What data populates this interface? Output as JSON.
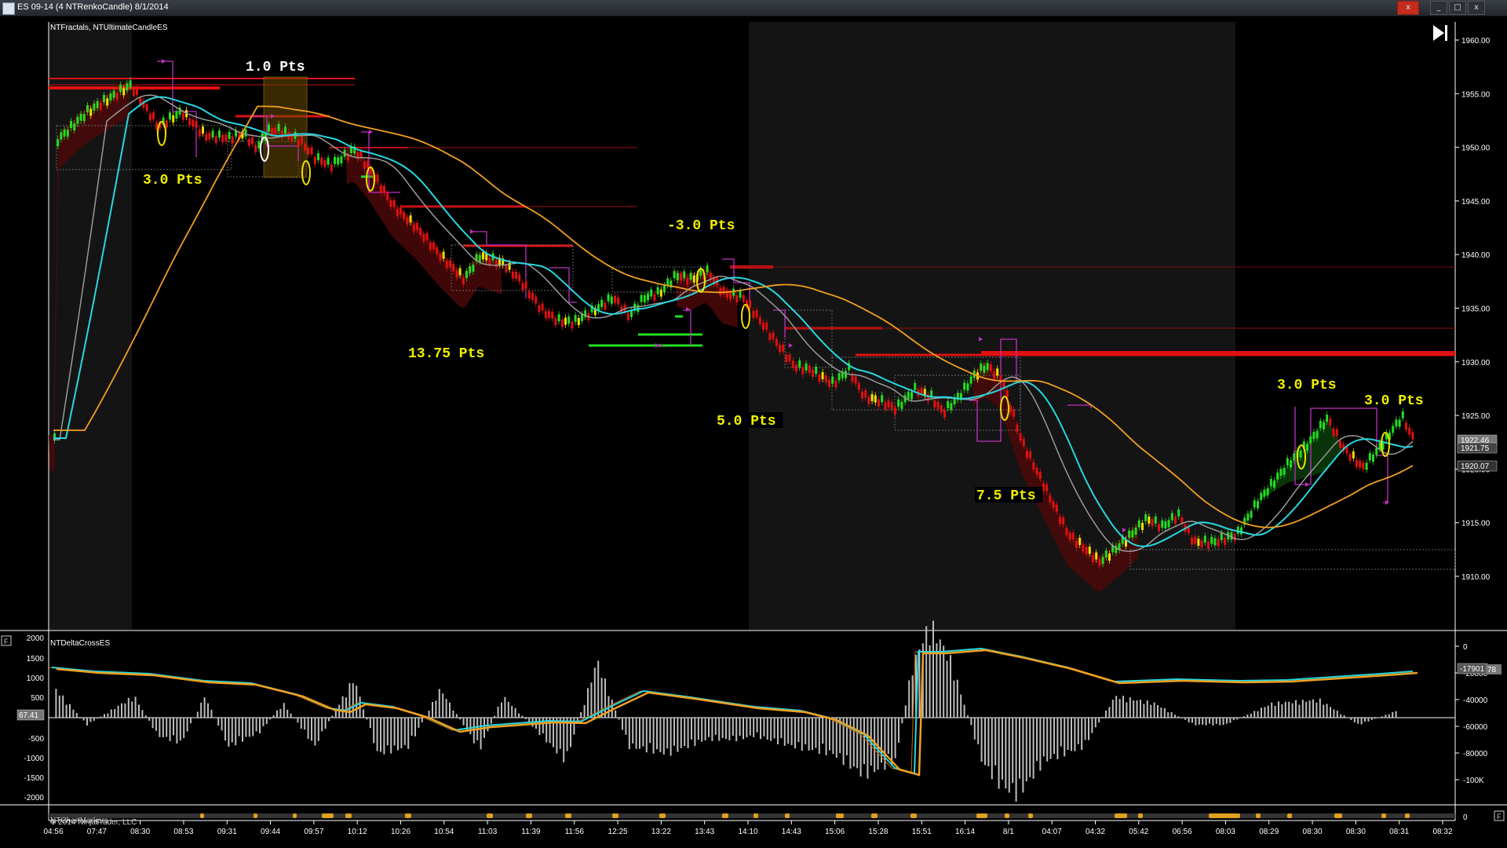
{
  "window": {
    "title": "ES 09-14 (4 NTRenkoCandle)  8/1/2014",
    "close_label": "x"
  },
  "main_panel": {
    "indicator_label": "NTFractals, NTUltimateCandleES",
    "price_ticks": [
      "1960.00",
      "1955.00",
      "1950.00",
      "1945.00",
      "1940.00",
      "1935.00",
      "1930.00",
      "1925.00",
      "1920.00",
      "1915.00",
      "1910.00"
    ],
    "price_flags": [
      "1922.46",
      "1921.75",
      "1920.07"
    ],
    "annotations": [
      "1.0  Pts",
      "3.0  Pts",
      "-3.0  Pts",
      "13.75  Pts",
      "5.0  Pts",
      "7.5  Pts",
      "3.0  Pts",
      "3.0  Pts"
    ]
  },
  "sub_panel": {
    "indicator_label": "NTDeltaCrossES",
    "left_ticks": [
      "2000",
      "1500",
      "1000",
      "500",
      "-500",
      "-1000",
      "-1500",
      "-2000"
    ],
    "left_flag": "67.41",
    "right_ticks": [
      "0",
      "-20000",
      "-40000",
      "-60000",
      "-80000",
      "-100K"
    ],
    "right_flag": "-17901",
    "right_flag2": "78"
  },
  "bottom_panel": {
    "label": "NTChartMarkers",
    "copyright": "© 2014 NinjaTrader, LLC",
    "right_tick": "0"
  },
  "time_axis": [
    "04:56",
    "07:47",
    "08:30",
    "08:53",
    "09:31",
    "09:44",
    "09:57",
    "10:12",
    "10:26",
    "10:54",
    "11:03",
    "11:39",
    "11:56",
    "12:25",
    "13:22",
    "13:43",
    "14:10",
    "14:43",
    "15:06",
    "15:28",
    "15:51",
    "16:14",
    "8/1",
    "04:07",
    "04:32",
    "05:42",
    "06:56",
    "08:03",
    "08:29",
    "08:30",
    "08:30",
    "08:31",
    "08:32"
  ],
  "colors": {
    "bull": "#22dd22",
    "bear": "#e01010",
    "cyan_ma": "#27d7e0",
    "orange_ma": "#f0a020",
    "gray_ma": "#9a9a9a",
    "fractal": "#c030c0",
    "annotation": "#f0f000"
  }
}
